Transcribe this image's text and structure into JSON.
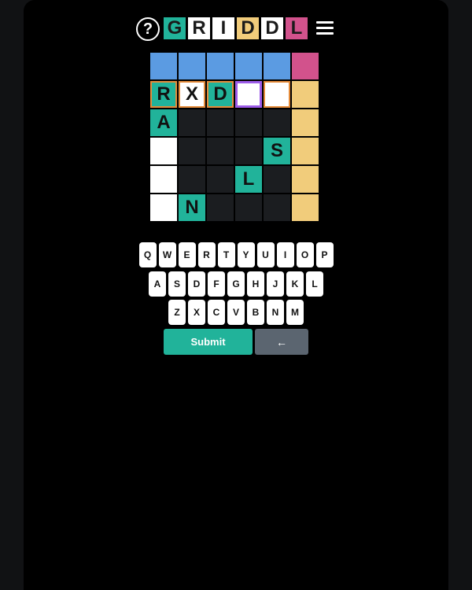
{
  "header": {
    "help_glyph": "?",
    "logo_letters": [
      {
        "letter": "G",
        "color": "#21b39a"
      },
      {
        "letter": "R",
        "color": "#ffffff"
      },
      {
        "letter": "I",
        "color": "#ffffff"
      },
      {
        "letter": "D",
        "color": "#f1cc7b"
      },
      {
        "letter": "D",
        "color": "#ffffff"
      },
      {
        "letter": "L",
        "color": "#d2528c"
      }
    ],
    "menu_icon": "hamburger-icon"
  },
  "colors": {
    "green": "#21b39a",
    "yellow": "#f1cc7b",
    "blue": "#5b9be2",
    "pink": "#d2528c",
    "white": "#ffffff",
    "dark_cell": "#1b1d20",
    "selected_border": "#9d5ce8",
    "word_border": "#e58b3a",
    "backspace": "#5b6570"
  },
  "grid": {
    "header_row": [
      "blue",
      "blue",
      "blue",
      "blue",
      "blue",
      "pink"
    ],
    "rows": [
      [
        {
          "letter": "R",
          "state": "green",
          "border": "orange"
        },
        {
          "letter": "X",
          "state": "white",
          "border": "orange"
        },
        {
          "letter": "D",
          "state": "green",
          "border": "orange"
        },
        {
          "letter": "",
          "state": "white",
          "border": "purple"
        },
        {
          "letter": "",
          "state": "white",
          "border": "orange"
        },
        {
          "letter": "",
          "state": "clue",
          "border": ""
        }
      ],
      [
        {
          "letter": "A",
          "state": "green",
          "border": ""
        },
        {
          "letter": "",
          "state": "dark",
          "border": ""
        },
        {
          "letter": "",
          "state": "dark",
          "border": ""
        },
        {
          "letter": "",
          "state": "dark",
          "border": ""
        },
        {
          "letter": "",
          "state": "dark",
          "border": ""
        },
        {
          "letter": "",
          "state": "clue",
          "border": ""
        }
      ],
      [
        {
          "letter": "",
          "state": "white",
          "border": ""
        },
        {
          "letter": "",
          "state": "dark",
          "border": ""
        },
        {
          "letter": "",
          "state": "dark",
          "border": ""
        },
        {
          "letter": "",
          "state": "dark",
          "border": ""
        },
        {
          "letter": "S",
          "state": "green",
          "border": ""
        },
        {
          "letter": "",
          "state": "clue",
          "border": ""
        }
      ],
      [
        {
          "letter": "",
          "state": "white",
          "border": ""
        },
        {
          "letter": "",
          "state": "dark",
          "border": ""
        },
        {
          "letter": "",
          "state": "dark",
          "border": ""
        },
        {
          "letter": "L",
          "state": "green",
          "border": ""
        },
        {
          "letter": "",
          "state": "dark",
          "border": ""
        },
        {
          "letter": "",
          "state": "clue",
          "border": ""
        }
      ],
      [
        {
          "letter": "",
          "state": "white",
          "border": ""
        },
        {
          "letter": "N",
          "state": "green",
          "border": ""
        },
        {
          "letter": "",
          "state": "dark",
          "border": ""
        },
        {
          "letter": "",
          "state": "dark",
          "border": ""
        },
        {
          "letter": "",
          "state": "dark",
          "border": ""
        },
        {
          "letter": "",
          "state": "clue",
          "border": ""
        }
      ]
    ]
  },
  "keyboard": {
    "rows": [
      [
        "Q",
        "W",
        "E",
        "R",
        "T",
        "Y",
        "U",
        "I",
        "O",
        "P"
      ],
      [
        "A",
        "S",
        "D",
        "F",
        "G",
        "H",
        "J",
        "K",
        "L"
      ],
      [
        "Z",
        "X",
        "C",
        "V",
        "B",
        "N",
        "M"
      ]
    ],
    "submit_label": "Submit",
    "backspace_glyph": "←"
  }
}
